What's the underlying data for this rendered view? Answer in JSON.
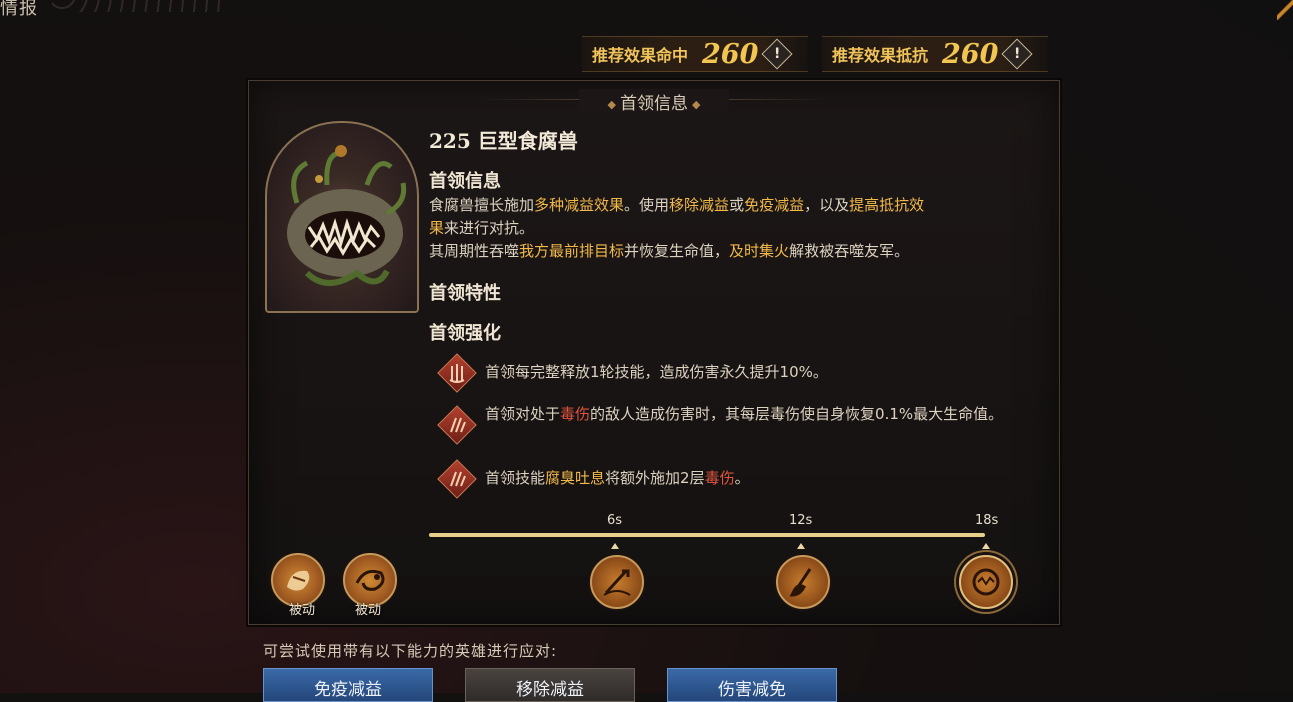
{
  "header": {
    "title": "情报"
  },
  "stats": [
    {
      "label": "推荐效果命中",
      "value": "260"
    },
    {
      "label": "推荐效果抵抗",
      "value": "260"
    }
  ],
  "panel": {
    "title": "首领信息",
    "boss_name": "225 巨型食腐兽",
    "info_heading": "首领信息",
    "info_desc": [
      [
        "食腐兽擅长施加",
        "多种减益效果",
        "。使用",
        "移除减益",
        "或",
        "免疫减益",
        "，以及",
        "提高抵抗效",
        ""
      ],
      [
        "果",
        "来进行对抗。"
      ],
      [
        "其周期性吞噬",
        "我方最前排目标",
        "并恢复生命值，",
        "及时集火",
        "解救被吞噬友军。"
      ]
    ],
    "traits_heading": "首领特性",
    "enhance_heading": "首领强化",
    "enhancements": [
      {
        "parts": [
          [
            "首领每完整释放1轮技能，造成伤害永久提升10%。",
            ""
          ]
        ]
      },
      {
        "parts": [
          [
            "首领对处于",
            ""
          ],
          [
            "毒伤",
            "r"
          ],
          [
            "的敌人造成伤害时，其每层毒伤使自身恢复0.1%最大生命值。",
            ""
          ]
        ]
      },
      {
        "parts": [
          [
            "首领技能",
            ""
          ],
          [
            "腐臭吐息",
            "y"
          ],
          [
            "将额外施加2层",
            ""
          ],
          [
            "毒伤",
            "r"
          ],
          [
            "。",
            ""
          ]
        ]
      }
    ],
    "passives": [
      {
        "label": "被动"
      },
      {
        "label": "被动"
      }
    ],
    "timeline": {
      "ticks": [
        "6s",
        "12s",
        "18s"
      ]
    }
  },
  "counter": {
    "label": "可尝试使用带有以下能力的英雄进行应对:",
    "tags": [
      {
        "label": "免疫减益",
        "style": "blue"
      },
      {
        "label": "移除减益",
        "style": "grey"
      },
      {
        "label": "伤害减免",
        "style": "blue"
      }
    ]
  },
  "colors": {
    "gold": "#f3c652",
    "highlight_yellow": "#f2b94a",
    "highlight_red": "#e0553f",
    "panel_border": "#4a3e33"
  }
}
